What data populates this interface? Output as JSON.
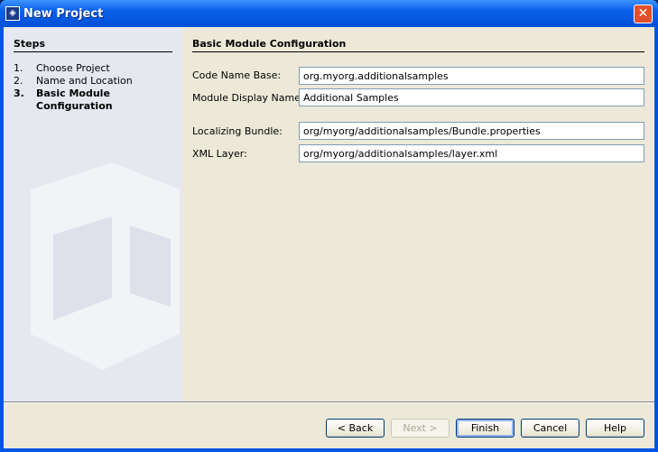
{
  "window": {
    "title": "New Project",
    "close": "✕"
  },
  "steps": {
    "heading": "Steps",
    "items": [
      {
        "num": "1.",
        "label": "Choose Project",
        "current": false
      },
      {
        "num": "2.",
        "label": "Name and Location",
        "current": false
      },
      {
        "num": "3.",
        "label": "Basic Module Configuration",
        "current": true
      }
    ]
  },
  "main": {
    "heading": "Basic Module Configuration",
    "fields": [
      {
        "label": "Code Name Base:",
        "value": "org.myorg.additionalsamples"
      },
      {
        "label": "Module Display Name:",
        "value": "Additional Samples"
      },
      {
        "label": "Localizing Bundle:",
        "value": "org/myorg/additionalsamples/Bundle.properties"
      },
      {
        "label": "XML Layer:",
        "value": "org/myorg/additionalsamples/layer.xml"
      }
    ]
  },
  "buttons": {
    "back": "< Back",
    "next": "Next >",
    "finish": "Finish",
    "cancel": "Cancel",
    "help": "Help"
  }
}
